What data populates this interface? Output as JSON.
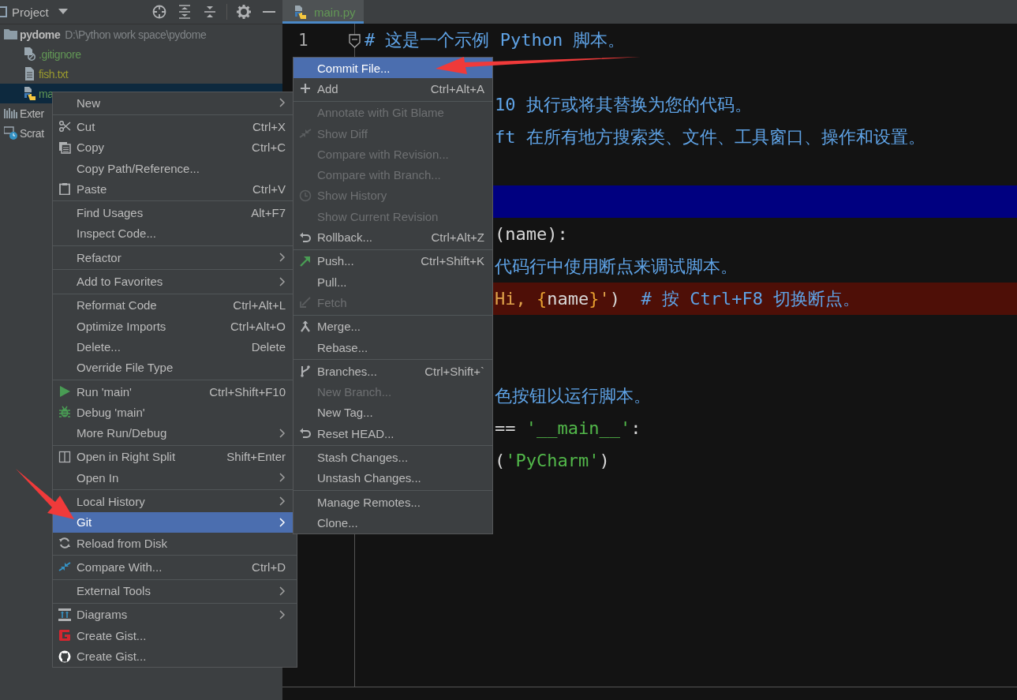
{
  "project_panel": {
    "title": "Project",
    "tree": [
      {
        "label": "pydome",
        "path": "D:\\Python work space\\pydome",
        "selected": false,
        "children": [
          {
            "label": ".gitignore",
            "color": "#629755",
            "selected": false
          },
          {
            "label": "fish.txt",
            "color": "#9a9a2e",
            "selected": false
          },
          {
            "label": "ma",
            "color": "#629755",
            "selected": true
          }
        ]
      },
      {
        "label": "Exter",
        "selected": false
      },
      {
        "label": "Scrat",
        "selected": false
      }
    ]
  },
  "editor": {
    "tab": {
      "label": "main.py",
      "selected": true
    },
    "lines": [
      {
        "number": "1",
        "tokens": [
          {
            "text": "# 这是一个示例 Python 脚本。",
            "kind": "comment"
          }
        ]
      },
      {
        "kind": "blank"
      },
      {
        "covered": true,
        "tokens": [
          {
            "text": "10 执行或将其替换为您的代码。",
            "kind": "comment"
          }
        ]
      },
      {
        "covered": true,
        "tokens": [
          {
            "text": "ft 在所有地方搜索类、文件、工具窗口、操作和设置。",
            "kind": "comment"
          }
        ]
      },
      {
        "kind": "blank"
      },
      {
        "kind": "selection"
      },
      {
        "covered": true,
        "tokens": [
          {
            "text": "(name):",
            "kind": "plain"
          }
        ]
      },
      {
        "covered": true,
        "tokens": [
          {
            "text": "代码行中使用断点来调试脚本。",
            "kind": "comment"
          }
        ]
      },
      {
        "covered": true,
        "kind": "breakpoint",
        "tokens": [
          {
            "text": "Hi, ",
            "kind": "fstring"
          },
          {
            "text": "{",
            "kind": "brace"
          },
          {
            "text": "name",
            "kind": "plain"
          },
          {
            "text": "}",
            "kind": "brace"
          },
          {
            "text": "'",
            "kind": "fstring"
          },
          {
            "text": ")  ",
            "kind": "plain"
          },
          {
            "text": "# 按 Ctrl+F8 切换断点。",
            "kind": "comment"
          }
        ]
      },
      {
        "kind": "blank"
      },
      {
        "kind": "blank"
      },
      {
        "covered": true,
        "tokens": [
          {
            "text": "色按钮以运行脚本。",
            "kind": "comment"
          }
        ]
      },
      {
        "covered": true,
        "tokens": [
          {
            "text": "== ",
            "kind": "plain"
          },
          {
            "text": "'__main__'",
            "kind": "string"
          },
          {
            "text": ":",
            "kind": "plain"
          }
        ]
      },
      {
        "covered": true,
        "tokens": [
          {
            "text": "(",
            "kind": "plain"
          },
          {
            "text": "'PyCharm'",
            "kind": "string"
          },
          {
            "text": ")",
            "kind": "plain"
          }
        ]
      }
    ]
  },
  "context_menu": {
    "groups": [
      {
        "items": [
          {
            "label": "New",
            "submenu": true,
            "disabled": false,
            "selected": false
          }
        ]
      },
      {
        "items": [
          {
            "label": "Cut",
            "shortcut": "Ctrl+X",
            "submenu": false,
            "disabled": false,
            "selected": false
          },
          {
            "label": "Copy",
            "shortcut": "Ctrl+C",
            "submenu": false,
            "disabled": false,
            "selected": false
          },
          {
            "label": "Copy Path/Reference...",
            "submenu": false,
            "disabled": false,
            "selected": false
          },
          {
            "label": "Paste",
            "shortcut": "Ctrl+V",
            "submenu": false,
            "disabled": false,
            "selected": false
          }
        ]
      },
      {
        "items": [
          {
            "label": "Find Usages",
            "shortcut": "Alt+F7",
            "submenu": false,
            "disabled": false,
            "selected": false
          },
          {
            "label": "Inspect Code...",
            "submenu": false,
            "disabled": false,
            "selected": false
          }
        ]
      },
      {
        "items": [
          {
            "label": "Refactor",
            "submenu": true,
            "disabled": false,
            "selected": false
          }
        ]
      },
      {
        "items": [
          {
            "label": "Add to Favorites",
            "submenu": true,
            "disabled": false,
            "selected": false
          }
        ]
      },
      {
        "items": [
          {
            "label": "Reformat Code",
            "shortcut": "Ctrl+Alt+L",
            "submenu": false,
            "disabled": false,
            "selected": false
          },
          {
            "label": "Optimize Imports",
            "shortcut": "Ctrl+Alt+O",
            "submenu": false,
            "disabled": false,
            "selected": false
          },
          {
            "label": "Delete...",
            "shortcut": "Delete",
            "submenu": false,
            "disabled": false,
            "selected": false
          },
          {
            "label": "Override File Type",
            "submenu": false,
            "disabled": false,
            "selected": false
          }
        ]
      },
      {
        "items": [
          {
            "label": "Run 'main'",
            "shortcut": "Ctrl+Shift+F10",
            "submenu": false,
            "disabled": false,
            "selected": false
          },
          {
            "label": "Debug 'main'",
            "submenu": false,
            "disabled": false,
            "selected": false
          },
          {
            "label": "More Run/Debug",
            "submenu": true,
            "disabled": false,
            "selected": false
          }
        ]
      },
      {
        "items": [
          {
            "label": "Open in Right Split",
            "shortcut": "Shift+Enter",
            "submenu": false,
            "disabled": false,
            "selected": false
          },
          {
            "label": "Open In",
            "submenu": true,
            "disabled": false,
            "selected": false
          }
        ]
      },
      {
        "items": [
          {
            "label": "Local History",
            "submenu": true,
            "disabled": false,
            "selected": false
          },
          {
            "label": "Git",
            "submenu": true,
            "disabled": false,
            "selected": true
          },
          {
            "label": "Reload from Disk",
            "submenu": false,
            "disabled": false,
            "selected": false
          }
        ]
      },
      {
        "items": [
          {
            "label": "Compare With...",
            "shortcut": "Ctrl+D",
            "submenu": false,
            "disabled": false,
            "selected": false
          }
        ]
      },
      {
        "items": [
          {
            "label": "External Tools",
            "submenu": true,
            "disabled": false,
            "selected": false
          }
        ]
      },
      {
        "items": [
          {
            "label": "Diagrams",
            "submenu": true,
            "disabled": false,
            "selected": false
          },
          {
            "label": "Create Gist...",
            "submenu": false,
            "disabled": false,
            "selected": false
          },
          {
            "label": "Create Gist...",
            "submenu": false,
            "disabled": false,
            "selected": false
          }
        ]
      }
    ]
  },
  "git_submenu": {
    "groups": [
      {
        "items": [
          {
            "label": "Commit File...",
            "disabled": false,
            "selected": true
          },
          {
            "label": "Add",
            "shortcut": "Ctrl+Alt+A",
            "disabled": false,
            "selected": false
          }
        ]
      },
      {
        "items": [
          {
            "label": "Annotate with Git Blame",
            "disabled": true,
            "selected": false
          },
          {
            "label": "Show Diff",
            "disabled": true,
            "selected": false
          },
          {
            "label": "Compare with Revision...",
            "disabled": true,
            "selected": false
          },
          {
            "label": "Compare with Branch...",
            "disabled": true,
            "selected": false
          },
          {
            "label": "Show History",
            "disabled": true,
            "selected": false
          },
          {
            "label": "Show Current Revision",
            "disabled": true,
            "selected": false
          },
          {
            "label": "Rollback...",
            "shortcut": "Ctrl+Alt+Z",
            "disabled": false,
            "selected": false
          }
        ]
      },
      {
        "items": [
          {
            "label": "Push...",
            "shortcut": "Ctrl+Shift+K",
            "disabled": false,
            "selected": false
          },
          {
            "label": "Pull...",
            "disabled": false,
            "selected": false
          },
          {
            "label": "Fetch",
            "disabled": true,
            "selected": false
          }
        ]
      },
      {
        "items": [
          {
            "label": "Merge...",
            "disabled": false,
            "selected": false
          },
          {
            "label": "Rebase...",
            "disabled": false,
            "selected": false
          }
        ]
      },
      {
        "items": [
          {
            "label": "Branches...",
            "shortcut": "Ctrl+Shift+`",
            "disabled": false,
            "selected": false
          },
          {
            "label": "New Branch...",
            "disabled": true,
            "selected": false
          },
          {
            "label": "New Tag...",
            "disabled": false,
            "selected": false
          },
          {
            "label": "Reset HEAD...",
            "disabled": false,
            "selected": false
          }
        ]
      },
      {
        "items": [
          {
            "label": "Stash Changes...",
            "disabled": false,
            "selected": false
          },
          {
            "label": "Unstash Changes...",
            "disabled": false,
            "selected": false
          }
        ]
      },
      {
        "items": [
          {
            "label": "Manage Remotes...",
            "disabled": false,
            "selected": false
          },
          {
            "label": "Clone...",
            "disabled": false,
            "selected": false
          }
        ]
      }
    ]
  }
}
